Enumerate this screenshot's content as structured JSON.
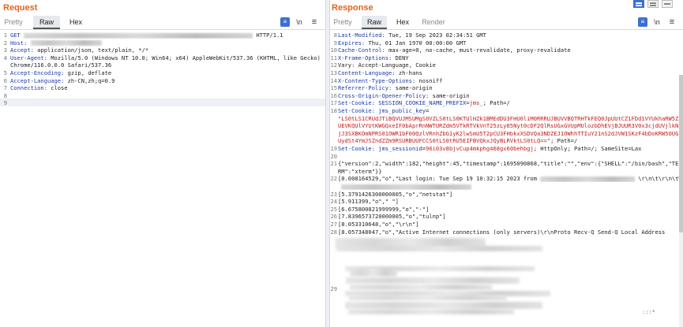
{
  "request": {
    "title": "Request",
    "tabs": [
      "Pretty",
      "Raw",
      "Hex"
    ],
    "active_tab": "Raw",
    "toolbar": {
      "wrap_icon": "wrap-icon",
      "newline_label": "\\n",
      "menu_icon": "menu-icon"
    },
    "lines": [
      {
        "n": "1",
        "key": "GET ",
        "val": "",
        "blur": 290,
        "tail": " HTTP/1.1"
      },
      {
        "n": "2",
        "key": "Host: ",
        "val": "",
        "blur": 90,
        "tail": ""
      },
      {
        "n": "3",
        "key": "Accept: ",
        "val": "application/json, text/plain, */*",
        "blur": 0,
        "tail": ""
      },
      {
        "n": "4",
        "key": "User-Agent: ",
        "val": "Mozilla/5.0 (Windows NT 10.0; Win64; x64) AppleWebKit/537.36 (KHTML, like Gecko)",
        "blur": 0,
        "tail": ""
      },
      {
        "n": "",
        "key": "",
        "val": "Chrome/116.0.0.0 Safari/537.36",
        "blur": 0,
        "tail": ""
      },
      {
        "n": "5",
        "key": "Accept-Encoding: ",
        "val": "gzip, deflate",
        "blur": 0,
        "tail": ""
      },
      {
        "n": "6",
        "key": "Accept-Language: ",
        "val": "zh-CN,zh;q=0.9",
        "blur": 0,
        "tail": ""
      },
      {
        "n": "7",
        "key": "Connection: ",
        "val": "close",
        "blur": 0,
        "tail": ""
      },
      {
        "n": "8",
        "key": "",
        "val": "",
        "blur": 0,
        "tail": ""
      },
      {
        "n": "9",
        "key": "",
        "val": "",
        "blur": 0,
        "tail": ""
      }
    ]
  },
  "response": {
    "title": "Response",
    "tabs": [
      "Pretty",
      "Raw",
      "Hex",
      "Render"
    ],
    "active_tab": "Raw",
    "toolbar": {
      "wrap_icon": "wrap-icon",
      "newline_label": "\\n",
      "menu_icon": "menu-icon"
    },
    "headers": [
      {
        "n": "8",
        "key": "Last-Modified: ",
        "val": "Tue, 19 Sep 2023 02:34:51 GMT"
      },
      {
        "n": "9",
        "key": "Expires: ",
        "val": "Thu, 01 Jan 1970 00:00:00 GMT"
      },
      {
        "n": "10",
        "key": "Cache-Control: ",
        "val": "max-age=0, no-cache, must-revalidate, proxy-revalidate"
      },
      {
        "n": "11",
        "key": "X-Frame-Options: ",
        "val": "DENY"
      },
      {
        "n": "12",
        "key": "",
        "val": "Vary: Accept-Language, Cookie"
      },
      {
        "n": "13",
        "key": "Content-Language: ",
        "val": "zh-hans"
      },
      {
        "n": "14",
        "key": "X-Content-Type-Options: ",
        "val": "nosniff"
      },
      {
        "n": "15",
        "key": "Referrer-Policy: ",
        "val": "same-origin"
      },
      {
        "n": "16",
        "key": "Cross-Origin-Opener-Policy: ",
        "val": "same-origin"
      }
    ],
    "cookie17": {
      "n": "17",
      "key": "Set-Cookie: ",
      "name": "SESSION_COOKIE_NAME_PREFIX",
      "eq": "=",
      "val": "jms_",
      "rest": "; Path=/"
    },
    "cookie18": {
      "n": "18",
      "key": "Set-Cookie: ",
      "name": "jms_public_key",
      "eq": "=",
      "key_lines": [
        "\"LS0tLS1CRUdJTiBQVUJMSUMgS0VZLS0tLS0KTUlHZk1BMEdDU3FHU0liM0RRRUJBUVVBQTRHTkFEQ0JpUUtCZ1FDd1VYUkhaRW5Z",
        "UEVKQUlVYUtKWGQxeIF0bAprRnNWTURZdm5VTkRTVkVnT25zLy85Nyt0cDF2QlRsUGxGVUpMUlozbDhEVjBJUUR3V0x3cjdUVjlkN",
        "jJ3SXBKOmNPRS01OWR1bF00QzlVRnhZbG1yK2lwSmU5T2pCU3FHbkxXSDVQa3NDZEJ1OWhhTTIuY21nS2dJVW1SKzF4bDoKRW5OUG",
        "UydSt4YmJSZndZZm9RSURBUUFCCS0tLS0tRU5EIFBVQkxJQyBLRVktLS0tLQ==\""
      ],
      "rest": "; Path=/"
    },
    "cookie19": {
      "n": "19",
      "key": "Set-Cookie: ",
      "name": "jms_sessionid",
      "eq": "=",
      "val": "96i03v8bjvCup4mkphg468gx60behbgj",
      "rest": "; HttpOnly; Path=/; SameSite=Lax"
    },
    "body_lines": [
      {
        "n": "20",
        "text": ""
      },
      {
        "n": "21",
        "text": "{\"version\":2,\"width\":182,\"height\":45,\"timestamp\":1695090868,\"title\":\"\",\"env\":{\"SHELL\":\"/bin/bash\",\"TE"
      },
      {
        "n": "",
        "text": "RM\":\"xterm\"}}"
      },
      {
        "n": "22",
        "text": "[0.008164529,\"o\",\"Last login: Tue Sep 19 10:32:15 2023 from",
        "blur": 120,
        "tail": "\\r\\n\\t\\r\\n\\tWelcome to"
      },
      {
        "n": "",
        "text": "",
        "blur": 165,
        "tail": ""
      },
      {
        "n": "23",
        "text": "[5.3791426300000005,\"o\",\"netstat\"]"
      },
      {
        "n": "24",
        "text": "[5.911399,\"o\",\" \"]"
      },
      {
        "n": "25",
        "text": "[6.675800821999999,\"o\",\"-\"]"
      },
      {
        "n": "26",
        "text": "[7.8396573720000005,\"o\",\"tulnp\"]"
      },
      {
        "n": "27",
        "text": "[8.053310648,\"o\",\"\\r\\n\"]"
      },
      {
        "n": "28",
        "text": "[8.057348047,\"o\",\"Active Internet connections (only servers)\\r\\nProto Recv-Q Send-Q Local Address"
      }
    ],
    "tail_lines": [
      {
        "n": "29",
        "text": ""
      }
    ],
    "overflow_mark": ":::*"
  },
  "layout_buttons": [
    "layout-split-icon",
    "layout-stack-icon",
    "layout-single-icon"
  ]
}
